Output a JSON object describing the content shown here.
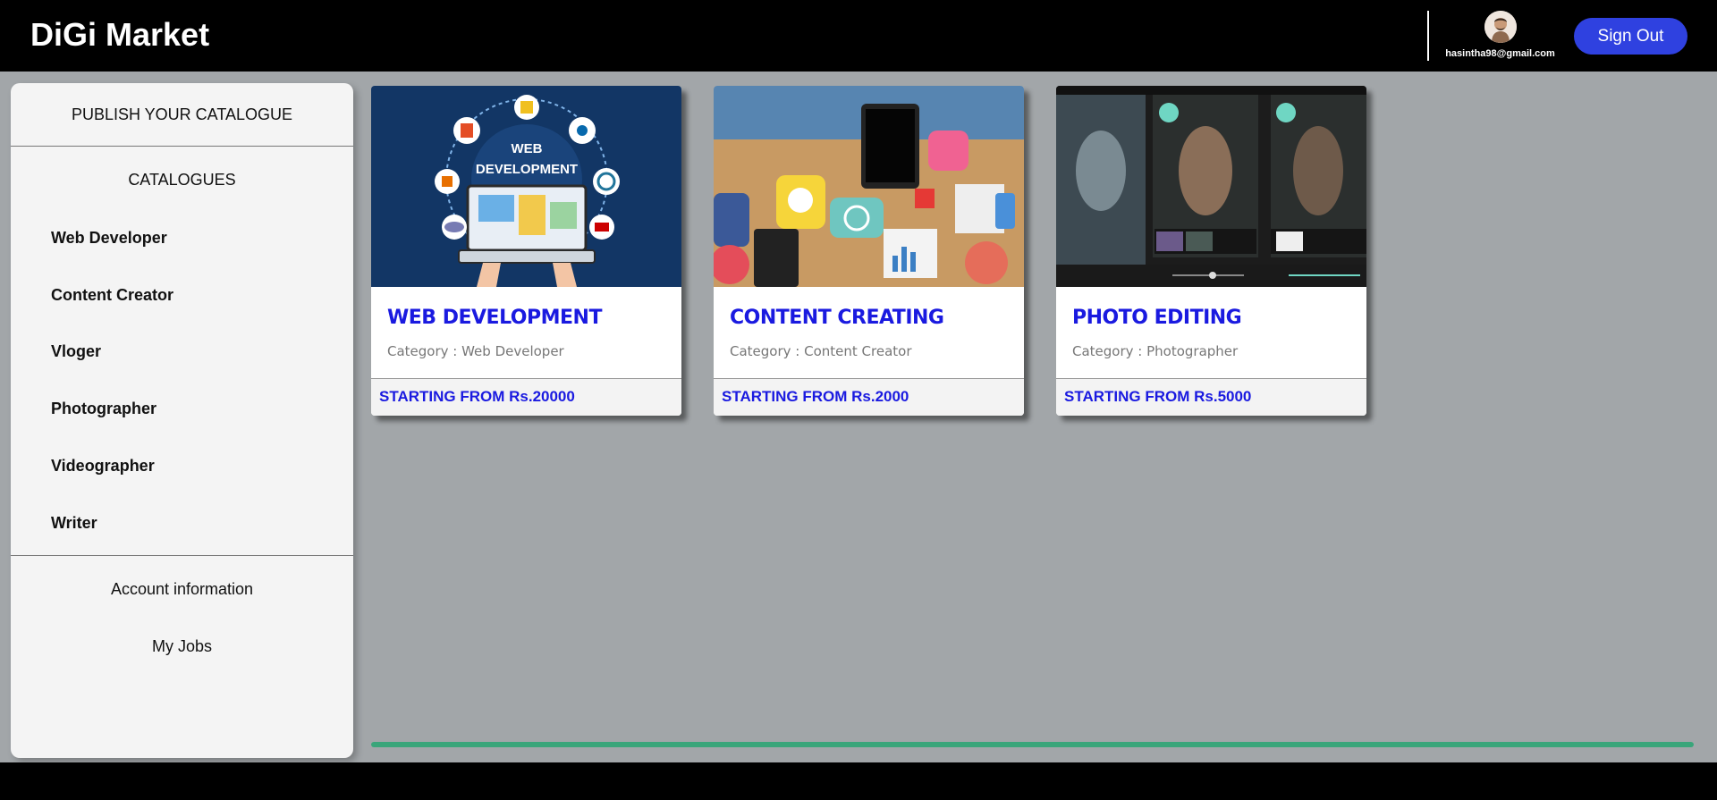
{
  "header": {
    "brand": "DiGi Market",
    "user_email": "hasintha98@gmail.com",
    "avatar_icon": "user-avatar-icon",
    "signout_label": "Sign Out"
  },
  "sidebar": {
    "publish_label": "PUBLISH YOUR CATALOGUE",
    "catalogues_heading": "CATALOGUES",
    "categories": [
      "Web Developer",
      "Content Creator",
      "Vloger",
      "Photographer",
      "Videographer",
      "Writer"
    ],
    "account_label": "Account information",
    "jobs_label": "My Jobs"
  },
  "cards": [
    {
      "title": "WEB DEVELOPMENT",
      "category": "Category : Web Developer",
      "price": "STARTING FROM Rs.20000",
      "image_text": [
        "WEB",
        "DEVELOPMENT"
      ]
    },
    {
      "title": "CONTENT CREATING",
      "category": "Category : Content Creator",
      "price": "STARTING FROM Rs.2000"
    },
    {
      "title": "PHOTO EDITING",
      "category": "Category : Photographer",
      "price": "STARTING FROM Rs.5000"
    }
  ],
  "progress": {
    "value": 1.0
  },
  "colors": {
    "accent": "#2f41e0",
    "title_blue": "#1a1ae0",
    "progress": "#3aa57a",
    "background": "#a2a6a9"
  }
}
